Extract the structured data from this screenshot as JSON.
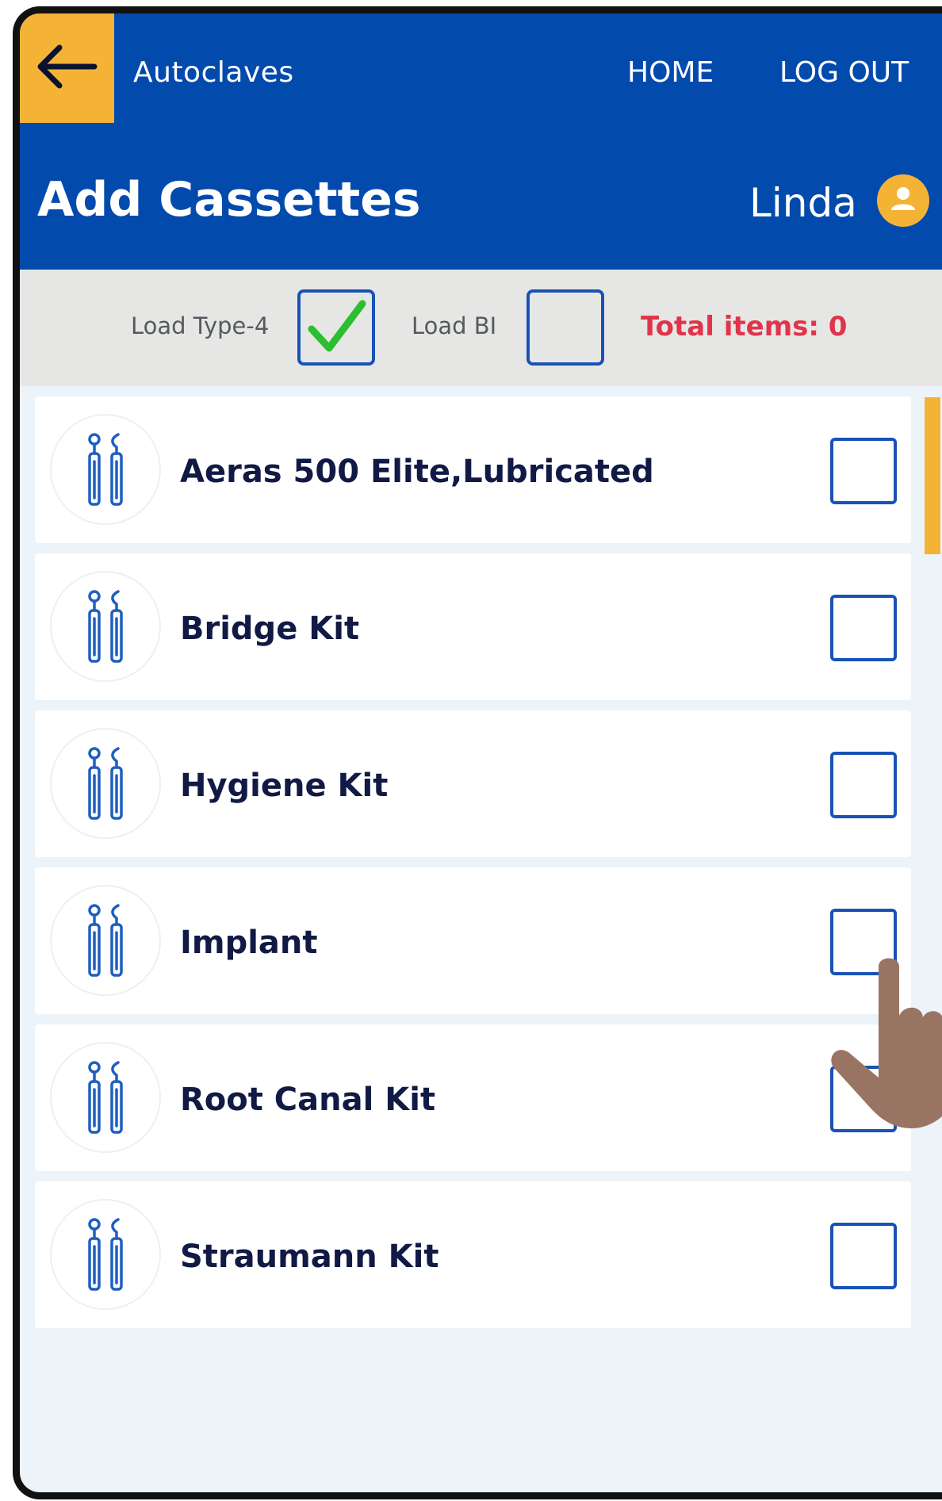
{
  "nav": {
    "back_icon": "arrow-left-icon",
    "title": "Autoclaves",
    "home": "HOME",
    "logout": "LOG OUT"
  },
  "header": {
    "page_title": "Add Cassettes",
    "user_name": "Linda",
    "avatar_icon": "user-icon"
  },
  "options": {
    "load_type_label": "Load Type-4",
    "load_type_checked": true,
    "load_bi_label": "Load BI",
    "load_bi_checked": false,
    "total_items": "Total items: 0"
  },
  "cassettes": [
    {
      "label": "Aeras 500 Elite,Lubricated",
      "checked": false,
      "icon": "dental-instruments-icon"
    },
    {
      "label": "Bridge Kit",
      "checked": false,
      "icon": "dental-instruments-icon"
    },
    {
      "label": "Hygiene Kit",
      "checked": false,
      "icon": "dental-instruments-icon"
    },
    {
      "label": "Implant",
      "checked": false,
      "icon": "dental-instruments-icon"
    },
    {
      "label": "Root Canal Kit",
      "checked": false,
      "icon": "dental-instruments-icon"
    },
    {
      "label": "Straumann Kit",
      "checked": false,
      "icon": "dental-instruments-icon"
    }
  ],
  "colors": {
    "primary": "#034aad",
    "accent": "#f5b335",
    "total_text": "#e1344a",
    "check": "#2bbf2f",
    "hand": "#9a7462"
  }
}
